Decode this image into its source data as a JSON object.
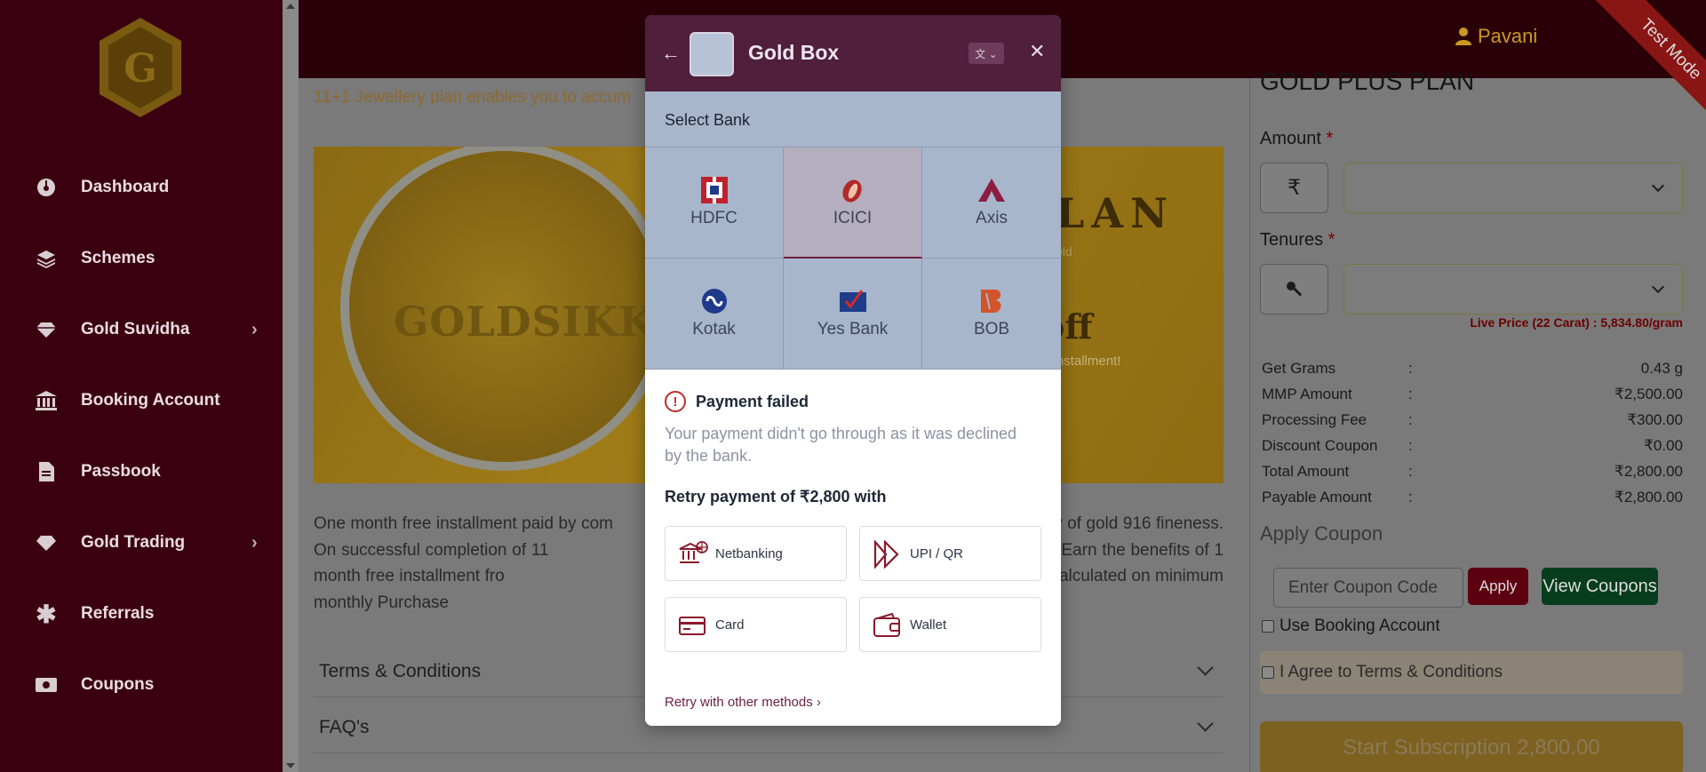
{
  "sidebar": {
    "items": [
      {
        "label": "Dashboard",
        "icon": "dashboard-icon"
      },
      {
        "label": "Schemes",
        "icon": "layers-icon"
      },
      {
        "label": "Gold Suvidha",
        "icon": "diamond-icon"
      },
      {
        "label": "Booking Account",
        "icon": "bank-icon"
      },
      {
        "label": "Passbook",
        "icon": "document-icon"
      },
      {
        "label": "Gold Trading",
        "icon": "diamond-icon"
      },
      {
        "label": "Referrals",
        "icon": "asterisk-icon"
      },
      {
        "label": "Coupons",
        "icon": "money-icon"
      }
    ]
  },
  "header": {
    "user_name": "Pavani",
    "ribbon": "Test Mode"
  },
  "main": {
    "intro": "11+1 Jewellery plan enables you to accum",
    "banner": {
      "brand": "GOLDSIKKA",
      "plan": "LAN",
      "gold": "old",
      "off": "off",
      "installment": "h installment!"
    },
    "description": "One month free installment paid by com                                                                                  t purity of gold 916 fineness. On successful completion of 11                                                                                  heir choice. Earn the benefits of 1 month free installment fro                                                                                  ur choice. Gold rate calculated on minimum monthly Purchase",
    "accordions": [
      "Terms & Conditions",
      "FAQ's"
    ]
  },
  "plan": {
    "title": "GOLD PLUS PLAN",
    "amount_label": "Amount",
    "tenures_label": "Tenures",
    "required_mark": "*",
    "currency_symbol": "₹",
    "live_price": "Live Price (22 Carat) : 5,834.80/gram",
    "summary": [
      {
        "k": "Get Grams",
        "v": "0.43 g"
      },
      {
        "k": "MMP Amount",
        "v": "₹2,500.00"
      },
      {
        "k": "Processing Fee",
        "v": "₹300.00"
      },
      {
        "k": "Discount Coupon",
        "v": "₹0.00"
      },
      {
        "k": "Total Amount",
        "v": "₹2,800.00"
      },
      {
        "k": "Payable Amount",
        "v": "₹2,800.00"
      }
    ],
    "separator": ":",
    "apply_coupon_title": "Apply Coupon",
    "coupon_placeholder": "Enter Coupon Code",
    "apply_label": "Apply",
    "view_coupons_label": "View Coupons",
    "use_booking_account": "Use Booking Account",
    "agree_terms": "I Agree to Terms & Conditions",
    "start_label": "Start Subscription 2,800.00"
  },
  "modal": {
    "title": "Gold Box",
    "select_bank": "Select Bank",
    "banks": [
      {
        "label": "HDFC",
        "color": "#c0212e"
      },
      {
        "label": "ICICI",
        "color": "#b02a2a"
      },
      {
        "label": "Axis",
        "color": "#8c1d40"
      },
      {
        "label": "Kotak",
        "color": "#1f3a8a"
      },
      {
        "label": "Yes Bank",
        "color": "#1d3c8a"
      },
      {
        "label": "BOB",
        "color": "#d2542a"
      }
    ],
    "fail_title": "Payment failed",
    "fail_message": "Your payment didn't go through as it was declined by the bank.",
    "retry_title": "Retry payment of ₹2,800 with",
    "methods": [
      {
        "label": "Netbanking",
        "icon": "bank-icon"
      },
      {
        "label": "UPI / QR",
        "icon": "upi-icon"
      },
      {
        "label": "Card",
        "icon": "card-icon"
      },
      {
        "label": "Wallet",
        "icon": "wallet-icon"
      }
    ],
    "retry_other": "Retry with other methods ›",
    "accent": "#6b1f3e"
  }
}
